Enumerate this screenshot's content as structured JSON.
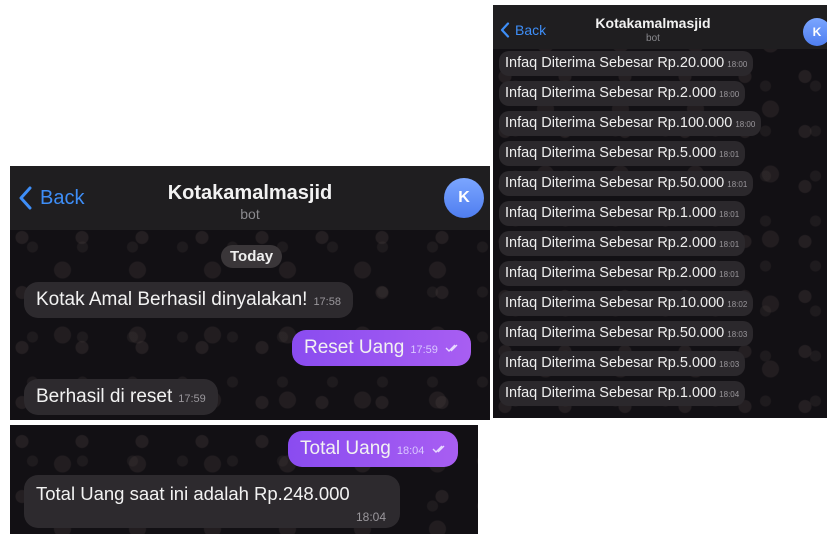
{
  "chat": {
    "back_label": "Back",
    "bot_name": "Kotakamalmasjid",
    "bot_status": "bot",
    "avatar_letter": "K"
  },
  "left_panel": {
    "day_separator": "Today",
    "messages": [
      {
        "text": "Kotak Amal Berhasil dinyalakan!",
        "time": "17:58",
        "direction": "incoming"
      },
      {
        "text": "Reset Uang",
        "time": "17:59",
        "direction": "outgoing",
        "status": "read"
      },
      {
        "text": "Berhasil di reset",
        "time": "17:59",
        "direction": "incoming"
      }
    ]
  },
  "bottom_panel": {
    "messages": [
      {
        "text": "Total Uang",
        "time": "18:04",
        "direction": "outgoing",
        "status": "read"
      },
      {
        "text": "Total Uang saat ini adalah Rp.248.000",
        "time": "18:04",
        "direction": "incoming"
      }
    ]
  },
  "right_panel": {
    "messages": [
      {
        "text": "Infaq Diterima Sebesar Rp.20.000",
        "time": "18:00"
      },
      {
        "text": "Infaq Diterima Sebesar Rp.2.000",
        "time": "18:00"
      },
      {
        "text": "Infaq Diterima Sebesar Rp.100.000",
        "time": "18:00"
      },
      {
        "text": "Infaq Diterima Sebesar Rp.5.000",
        "time": "18:01"
      },
      {
        "text": "Infaq Diterima Sebesar Rp.50.000",
        "time": "18:01"
      },
      {
        "text": "Infaq Diterima Sebesar Rp.1.000",
        "time": "18:01"
      },
      {
        "text": "Infaq Diterima Sebesar Rp.2.000",
        "time": "18:01"
      },
      {
        "text": "Infaq Diterima Sebesar Rp.2.000",
        "time": "18:01"
      },
      {
        "text": "Infaq Diterima Sebesar Rp.10.000",
        "time": "18:02"
      },
      {
        "text": "Infaq Diterima Sebesar Rp.50.000",
        "time": "18:03"
      },
      {
        "text": "Infaq Diterima Sebesar Rp.5.000",
        "time": "18:03"
      },
      {
        "text": "Infaq Diterima Sebesar Rp.1.000",
        "time": "18:04"
      }
    ]
  },
  "colors": {
    "accent": "#3e8ef7",
    "outgoing_bubble": "#9b57f2",
    "incoming_bubble": "#2d2a2e",
    "chat_background": "#121014"
  }
}
